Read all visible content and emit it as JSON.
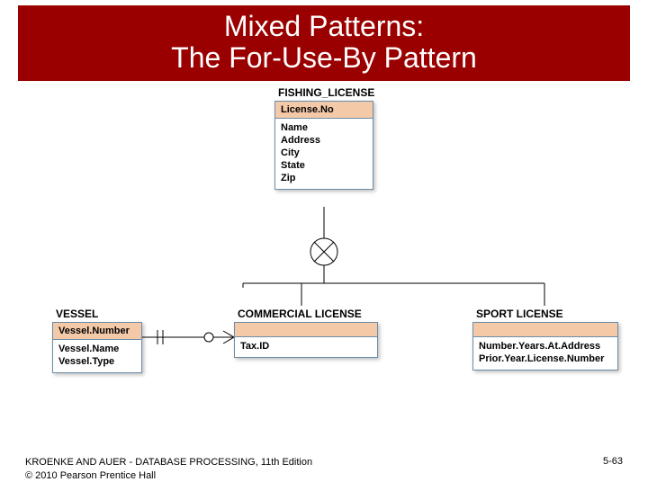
{
  "header": {
    "title_line1": "Mixed Patterns:",
    "title_line2": "The For-Use-By Pattern"
  },
  "entities": {
    "fishing_license": {
      "title": "FISHING_LICENSE",
      "pk": "License.No",
      "attrs": [
        "Name",
        "Address",
        "City",
        "State",
        "Zip"
      ]
    },
    "vessel": {
      "title": "VESSEL",
      "pk": "Vessel.Number",
      "attrs": [
        "Vessel.Name",
        "Vessel.Type"
      ]
    },
    "commercial_license": {
      "title": "COMMERCIAL LICENSE",
      "pk": "",
      "attrs": [
        "Tax.ID"
      ]
    },
    "sport_license": {
      "title": "SPORT LICENSE",
      "pk": "",
      "attrs": [
        "Number.Years.At.Address",
        "Prior.Year.License.Number"
      ]
    }
  },
  "footer": {
    "credit_line1": "KROENKE AND AUER - DATABASE PROCESSING, 11th Edition",
    "credit_line2": "© 2010 Pearson Prentice Hall",
    "page": "5-63"
  }
}
